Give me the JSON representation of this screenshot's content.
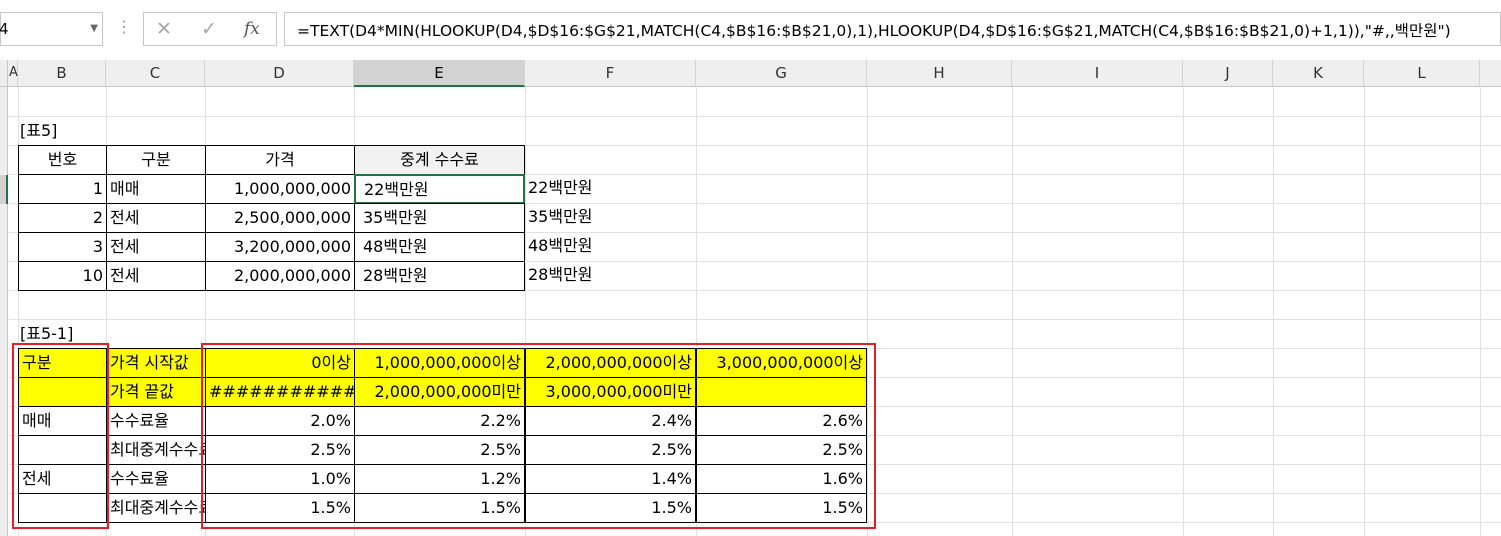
{
  "name_box": "4",
  "formula_bar": {
    "cancel_icon": "✕",
    "enter_icon": "✓",
    "fx_icon": "fx",
    "formula": "=TEXT(D4*MIN(HLOOKUP(D4,$D$16:$G$21,MATCH(C4,$B$16:$B$21,0),1),HLOOKUP(D4,$D$16:$G$21,MATCH(C4,$B$16:$B$21,0)+1,1)),\"#,,백만원\")"
  },
  "columns": [
    "A",
    "B",
    "C",
    "D",
    "E",
    "F",
    "G",
    "H",
    "I",
    "J",
    "K",
    "L"
  ],
  "table5": {
    "title": "[표5]",
    "headers": [
      "번호",
      "구분",
      "가격",
      "중계 수수료"
    ],
    "rows": [
      {
        "no": "1",
        "type": "매매",
        "price": "1,000,000,000",
        "fee": "22백만원",
        "side": "22백만원"
      },
      {
        "no": "2",
        "type": "전세",
        "price": "2,500,000,000",
        "fee": "35백만원",
        "side": "35백만원"
      },
      {
        "no": "3",
        "type": "전세",
        "price": "3,200,000,000",
        "fee": "48백만원",
        "side": "48백만원"
      },
      {
        "no": "10",
        "type": "전세",
        "price": "2,000,000,000",
        "fee": "28백만원",
        "side": "28백만원"
      }
    ]
  },
  "table51": {
    "title": "[표5-1]",
    "row1": {
      "b": "구분",
      "c": "가격 시작값",
      "d": "0이상",
      "e": "1,000,000,000이상",
      "f": "2,000,000,000이상",
      "g": "3,000,000,000이상"
    },
    "row2": {
      "b": "",
      "c": "가격 끝값",
      "d": "############",
      "e": "2,000,000,000미만",
      "f": "3,000,000,000미만",
      "g": ""
    },
    "row3": {
      "b": "매매",
      "c": "수수료율",
      "d": "2.0%",
      "e": "2.2%",
      "f": "2.4%",
      "g": "2.6%"
    },
    "row4": {
      "b": "",
      "c": "최대중계수수료율",
      "d": "2.5%",
      "e": "2.5%",
      "f": "2.5%",
      "g": "2.5%"
    },
    "row5": {
      "b": "전세",
      "c": "수수료율",
      "d": "1.0%",
      "e": "1.2%",
      "f": "1.4%",
      "g": "1.6%"
    },
    "row6": {
      "b": "",
      "c": "최대중계수수료율",
      "d": "1.5%",
      "e": "1.5%",
      "f": "1.5%",
      "g": "1.5%"
    }
  },
  "colors": {
    "highlight": "#ffff00",
    "selection": "#217346",
    "redbox": "#e0202a"
  }
}
